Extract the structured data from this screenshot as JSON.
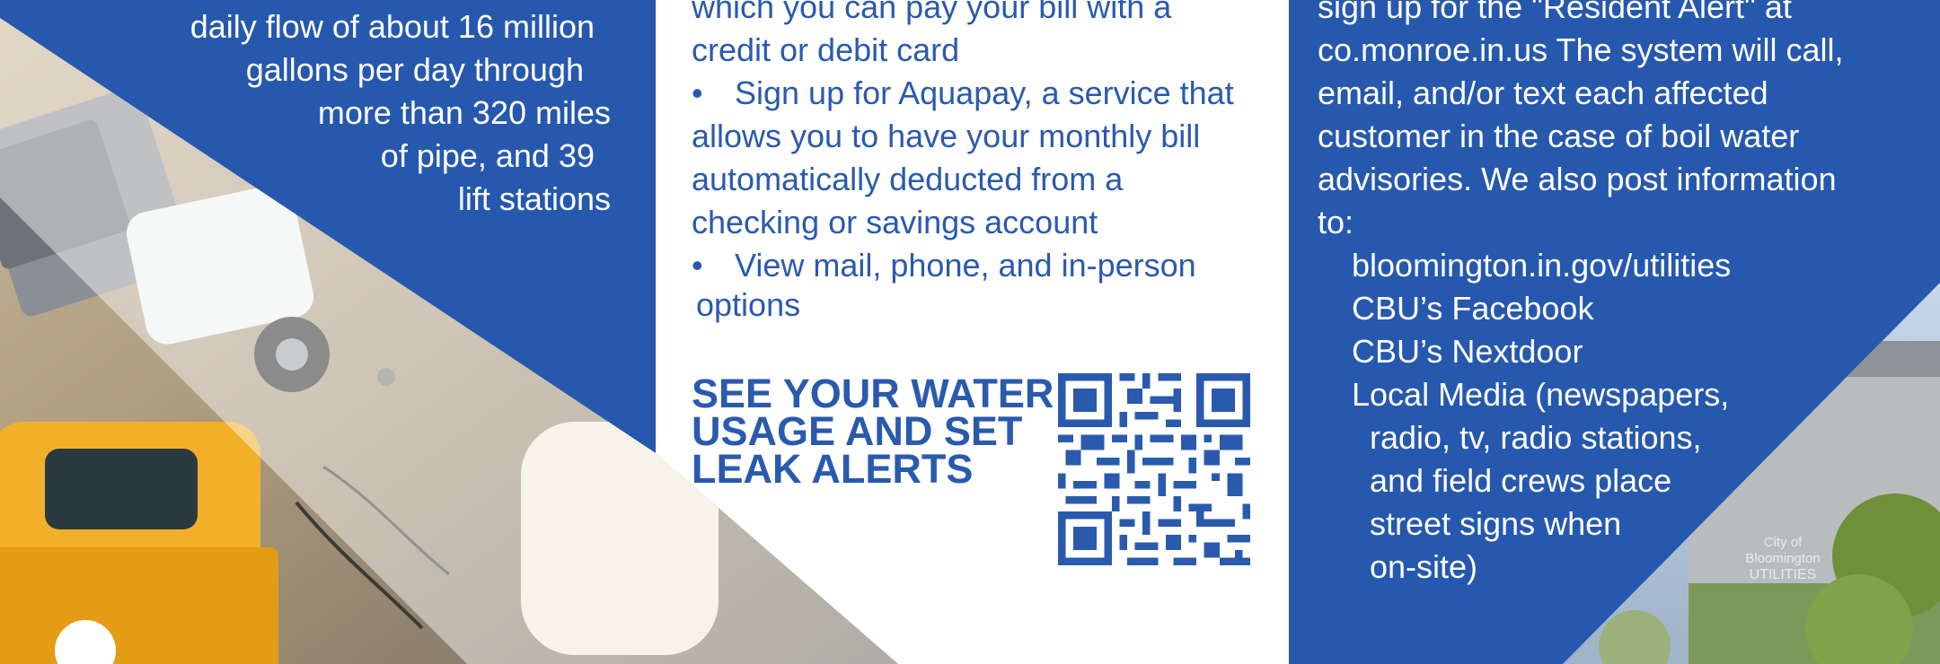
{
  "left_panel": {
    "lines": [
      "daily flow of about 16 million",
      "gallons per day through",
      "more than 320 miles",
      "of pipe, and 39",
      "lift stations"
    ]
  },
  "middle_panel": {
    "line_top_1": "which you can pay your bill with a",
    "line_top_2": "credit or debit card",
    "bullet_symbol": "•",
    "bullet_aquapay": {
      "line1": "Sign up for Aquapay, a service that",
      "line2": "allows you to have your monthly bill",
      "line3": "automatically deducted from a",
      "line4": "checking or savings account"
    },
    "bullet_view": {
      "line1": "View mail, phone, and in-person",
      "line2": "options"
    },
    "cta": {
      "line1": "SEE YOUR WATER",
      "line2": "USAGE AND SET",
      "line3": "LEAK ALERTS"
    }
  },
  "right_panel": {
    "lines": [
      "sign up for the \"Resident Alert\" at",
      "co.monroe.in.us The system will call,",
      "email, and/or text each affected",
      "customer in the case of boil water",
      "advisories. We also post information",
      "to:"
    ],
    "links": [
      "bloomington.in.gov/utilities",
      "CBU’s Facebook",
      "CBU’s Nextdoor",
      "Local Media (newspapers,"
    ],
    "media_sub": [
      "radio, tv, radio stations,",
      "and field crews place",
      "street signs when",
      "on-site)"
    ],
    "building_sign": {
      "line1": "City of Bloomington",
      "line2": "UTILITIES"
    }
  },
  "colors": {
    "brand_blue": "#2658ad",
    "text_blue": "#2a5aad",
    "white": "#ffffff"
  }
}
